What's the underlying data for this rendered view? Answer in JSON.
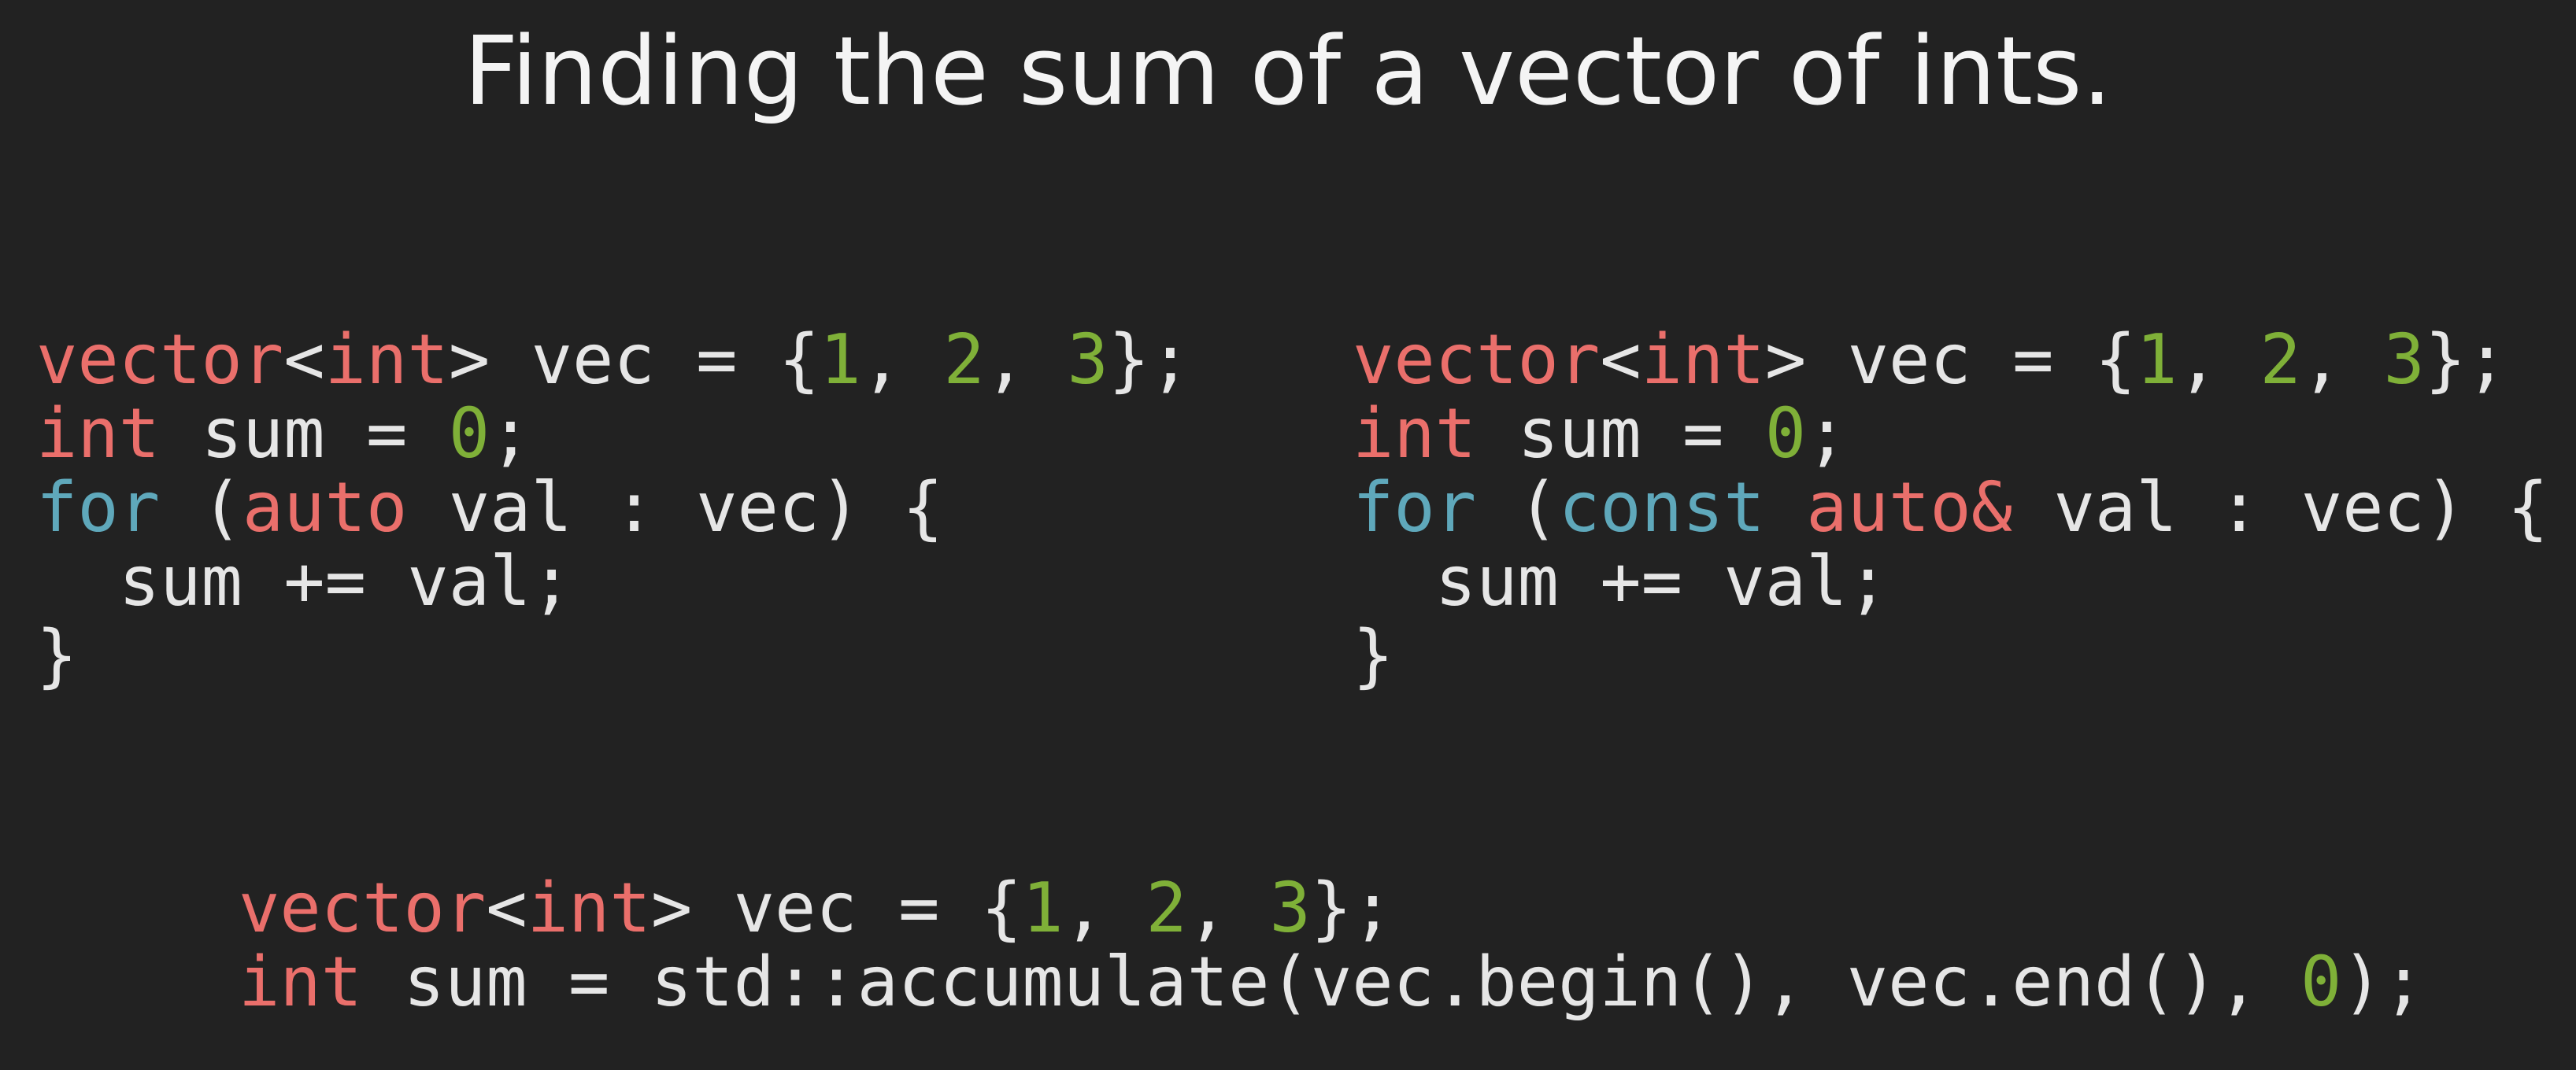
{
  "slide": {
    "title": "Finding the sum of a vector of ints."
  },
  "colors": {
    "background": "#222222",
    "text": "#e6e6e6",
    "type_keyword": "#ea6f6b",
    "control_keyword": "#5fa8bb",
    "number_literal": "#7fb038"
  },
  "code_blocks": [
    {
      "lines": [
        [
          {
            "text": "vector",
            "kind": "type"
          },
          {
            "text": "<",
            "kind": "plain"
          },
          {
            "text": "int",
            "kind": "type"
          },
          {
            "text": "> vec = {",
            "kind": "plain"
          },
          {
            "text": "1",
            "kind": "num"
          },
          {
            "text": ", ",
            "kind": "plain"
          },
          {
            "text": "2",
            "kind": "num"
          },
          {
            "text": ", ",
            "kind": "plain"
          },
          {
            "text": "3",
            "kind": "num"
          },
          {
            "text": "};",
            "kind": "plain"
          }
        ],
        [
          {
            "text": "int",
            "kind": "type"
          },
          {
            "text": " sum = ",
            "kind": "plain"
          },
          {
            "text": "0",
            "kind": "num"
          },
          {
            "text": ";",
            "kind": "plain"
          }
        ],
        [
          {
            "text": "for",
            "kind": "ctrl"
          },
          {
            "text": " (",
            "kind": "plain"
          },
          {
            "text": "auto",
            "kind": "type"
          },
          {
            "text": " val : vec) {",
            "kind": "plain"
          }
        ],
        [
          {
            "text": "  sum += val;",
            "kind": "plain"
          }
        ],
        [
          {
            "text": "}",
            "kind": "plain"
          }
        ]
      ]
    },
    {
      "lines": [
        [
          {
            "text": "vector",
            "kind": "type"
          },
          {
            "text": "<",
            "kind": "plain"
          },
          {
            "text": "int",
            "kind": "type"
          },
          {
            "text": "> vec = {",
            "kind": "plain"
          },
          {
            "text": "1",
            "kind": "num"
          },
          {
            "text": ", ",
            "kind": "plain"
          },
          {
            "text": "2",
            "kind": "num"
          },
          {
            "text": ", ",
            "kind": "plain"
          },
          {
            "text": "3",
            "kind": "num"
          },
          {
            "text": "};",
            "kind": "plain"
          }
        ],
        [
          {
            "text": "int",
            "kind": "type"
          },
          {
            "text": " sum = ",
            "kind": "plain"
          },
          {
            "text": "0",
            "kind": "num"
          },
          {
            "text": ";",
            "kind": "plain"
          }
        ],
        [
          {
            "text": "for",
            "kind": "ctrl"
          },
          {
            "text": " (",
            "kind": "plain"
          },
          {
            "text": "const",
            "kind": "ctrl"
          },
          {
            "text": " ",
            "kind": "plain"
          },
          {
            "text": "auto",
            "kind": "type"
          },
          {
            "text": "&",
            "kind": "type"
          },
          {
            "text": " val : vec) {",
            "kind": "plain"
          }
        ],
        [
          {
            "text": "  sum += val;",
            "kind": "plain"
          }
        ],
        [
          {
            "text": "}",
            "kind": "plain"
          }
        ]
      ]
    },
    {
      "lines": [
        [
          {
            "text": "vector",
            "kind": "type"
          },
          {
            "text": "<",
            "kind": "plain"
          },
          {
            "text": "int",
            "kind": "type"
          },
          {
            "text": "> vec = {",
            "kind": "plain"
          },
          {
            "text": "1",
            "kind": "num"
          },
          {
            "text": ", ",
            "kind": "plain"
          },
          {
            "text": "2",
            "kind": "num"
          },
          {
            "text": ", ",
            "kind": "plain"
          },
          {
            "text": "3",
            "kind": "num"
          },
          {
            "text": "};",
            "kind": "plain"
          }
        ],
        [
          {
            "text": "int",
            "kind": "type"
          },
          {
            "text": " sum = std::accumulate(vec.begin(), vec.end(), ",
            "kind": "plain"
          },
          {
            "text": "0",
            "kind": "num"
          },
          {
            "text": ");",
            "kind": "plain"
          }
        ]
      ]
    }
  ]
}
